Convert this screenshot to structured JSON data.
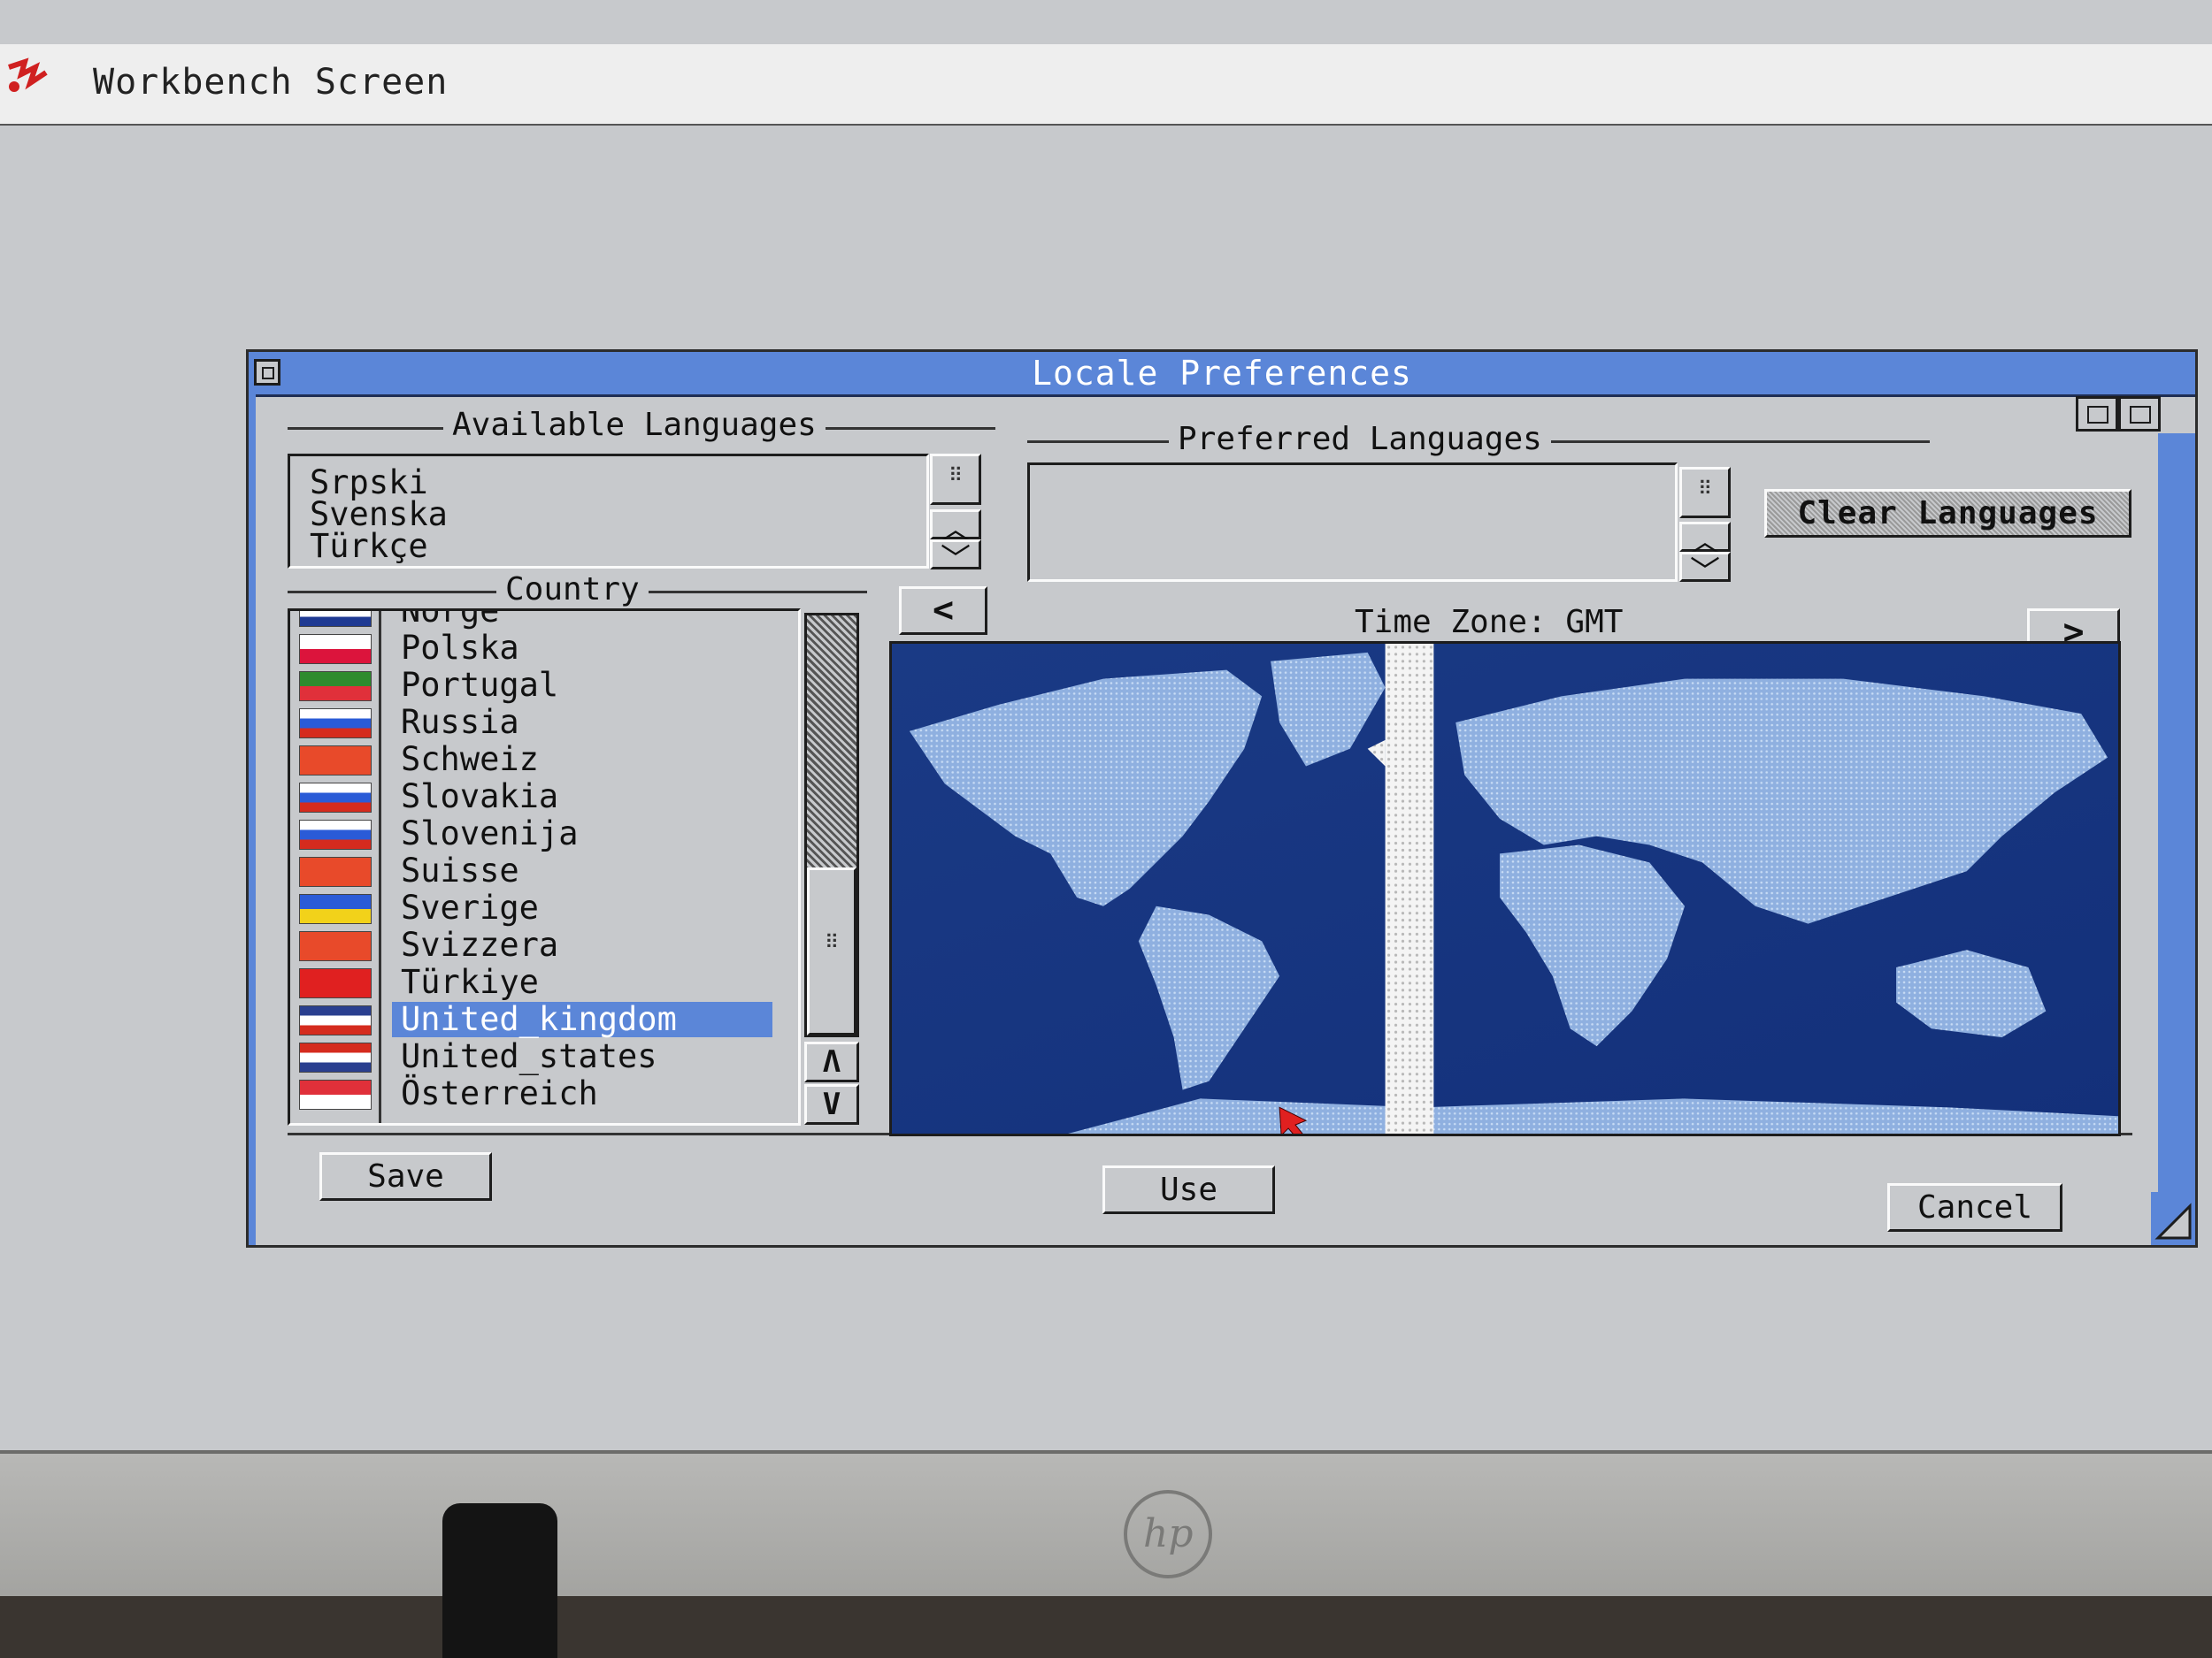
{
  "screen": {
    "title": "Workbench Screen"
  },
  "window": {
    "title": "Locale Preferences"
  },
  "available_languages": {
    "label": "Available Languages",
    "items": [
      "Srpski",
      "Svenska",
      "Türkçe"
    ]
  },
  "preferred_languages": {
    "label": "Preferred Languages",
    "items": []
  },
  "clear_languages_button": "Clear Languages",
  "country": {
    "label": "Country",
    "items": [
      {
        "name": "Norge",
        "flag": [
          "#d52b1e",
          "#ffffff",
          "#1f3a93"
        ]
      },
      {
        "name": "Polska",
        "flag": [
          "#ffffff",
          "#dc143c"
        ]
      },
      {
        "name": "Portugal",
        "flag": [
          "#2e8b2e",
          "#e0303a"
        ]
      },
      {
        "name": "Russia",
        "flag": [
          "#ffffff",
          "#2a5bd7",
          "#d52b1e"
        ]
      },
      {
        "name": "Schweiz",
        "flag": [
          "#e84a2a"
        ]
      },
      {
        "name": "Slovakia",
        "flag": [
          "#ffffff",
          "#2a5bd7",
          "#d52b1e"
        ]
      },
      {
        "name": "Slovenija",
        "flag": [
          "#ffffff",
          "#2a5bd7",
          "#d52b1e"
        ]
      },
      {
        "name": "Suisse",
        "flag": [
          "#e84a2a"
        ]
      },
      {
        "name": "Sverige",
        "flag": [
          "#2a5bd7",
          "#f2d21a"
        ]
      },
      {
        "name": "Svizzera",
        "flag": [
          "#e84a2a"
        ]
      },
      {
        "name": "Türkiye",
        "flag": [
          "#e02020"
        ]
      },
      {
        "name": "United_kingdom",
        "flag": [
          "#2a3f8f",
          "#ffffff",
          "#d52b1e"
        ],
        "selected": true
      },
      {
        "name": "United_states",
        "flag": [
          "#d52b1e",
          "#ffffff",
          "#2a3f8f"
        ]
      },
      {
        "name": "Österreich",
        "flag": [
          "#e0303a",
          "#ffffff"
        ]
      }
    ]
  },
  "time_zone": {
    "label": "Time Zone: GMT"
  },
  "buttons": {
    "save": "Save",
    "use": "Use",
    "cancel": "Cancel",
    "tz_prev": "<",
    "tz_next": ">"
  },
  "colors": {
    "title_bar": "#5b86d8",
    "selection": "#5b86d8",
    "map_ocean": "#1c3f8c",
    "map_land": "#8fb0e0"
  },
  "icons": {
    "scroll_up": "chevron-up-icon",
    "scroll_down": "chevron-down-icon",
    "close": "close-gadget-icon",
    "depth": "depth-gadget-icon",
    "zoom": "zoom-gadget-icon",
    "resize": "resize-gadget-icon"
  }
}
